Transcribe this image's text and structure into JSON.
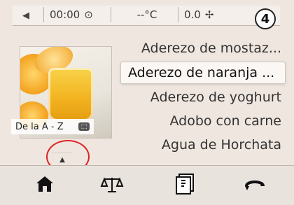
{
  "status": {
    "time": "00:00",
    "temperature": "--°C",
    "speed": "0.0",
    "step": "4"
  },
  "photo": {
    "label": "De la A - Z"
  },
  "recipes": [
    "Aderezo de mostaz...",
    "Aderezo de naranja ...",
    "Aderezo de yoghurt",
    "Adobo con carne",
    "Agua de Horchata"
  ],
  "icons": {
    "back": "left-arrow-icon",
    "clock": "clock-icon",
    "speed": "speed-icon",
    "scroll": "up-arrow-icon",
    "home": "home-icon",
    "scale": "scale-icon",
    "book": "recipe-book-icon",
    "turbo": "turbo-icon"
  },
  "colors": {
    "highlight": "#dd2222"
  }
}
